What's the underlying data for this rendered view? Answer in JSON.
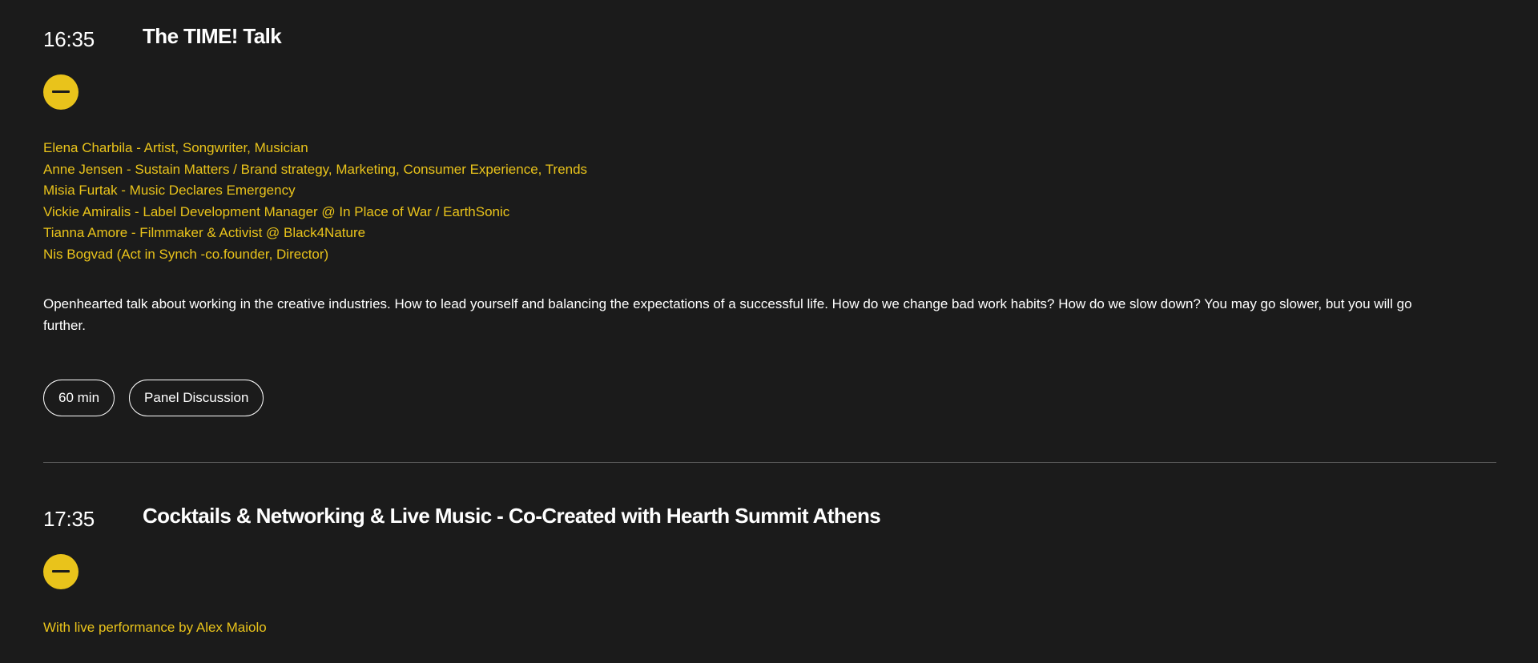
{
  "sessions": [
    {
      "time": "16:35",
      "title": "The TIME! Talk",
      "speakers": [
        "Elena Charbila - Artist, Songwriter, Musician",
        "Anne Jensen - Sustain Matters / Brand strategy, Marketing, Consumer Experience, Trends",
        "Misia Furtak - Music Declares Emergency",
        "Vickie Amiralis - Label Development Manager @ In Place of War / EarthSonic",
        "Tianna Amore - Filmmaker & Activist @ Black4Nature",
        "Nis Bogvad (Act in Synch -co.founder, Director)"
      ],
      "description": "Openhearted talk about working in the creative industries. How to lead yourself and balancing the expectations of a successful life. How do we change bad work habits? How do we slow down? You may go slower, but you will go further.",
      "tags": [
        "60 min",
        "Panel Discussion"
      ],
      "toggle_icon": "minus-icon"
    },
    {
      "time": "17:35",
      "title": "Cocktails & Networking & Live Music - Co-Created with Hearth Summit Athens",
      "speakers": [
        "With live performance by Alex Maiolo"
      ],
      "toggle_icon": "minus-icon"
    }
  ],
  "colors": {
    "background": "#1b1b1b",
    "accent": "#e9c31b",
    "text": "#ffffff",
    "divider": "#5a5a5a"
  }
}
